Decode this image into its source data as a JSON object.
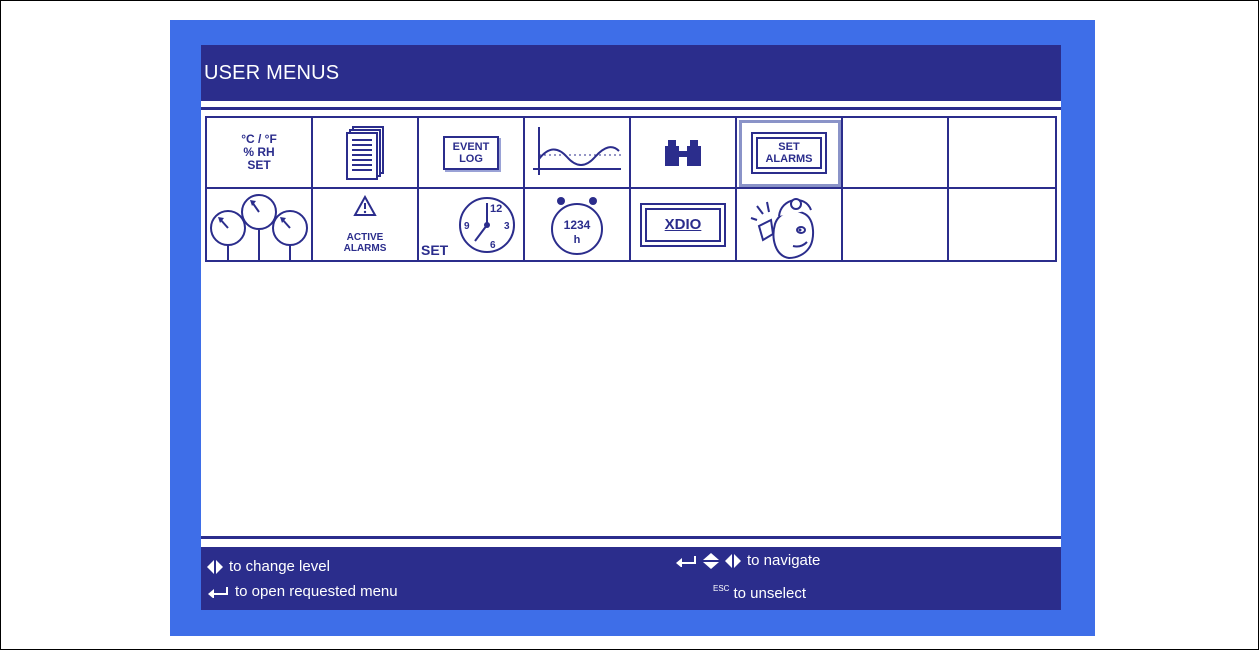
{
  "title": "USER MENUS",
  "menu_grid": {
    "row1": [
      {
        "name": "setpoints",
        "label": "°C / °F\n% RH\nSET",
        "icon": "temperature-humidity-set-icon"
      },
      {
        "name": "data-log",
        "icon": "document-stack-icon"
      },
      {
        "name": "event-log",
        "label": "EVENT\nLOG",
        "icon": "event-log-icon"
      },
      {
        "name": "graphs",
        "icon": "line-graph-icon"
      },
      {
        "name": "view",
        "icon": "binoculars-icon"
      },
      {
        "name": "set-alarms",
        "label": "SET\nALARMS",
        "icon": "set-alarms-icon",
        "selected": true
      },
      {
        "name": "empty-1",
        "icon": ""
      },
      {
        "name": "empty-2",
        "icon": ""
      }
    ],
    "row2": [
      {
        "name": "sensors",
        "icon": "gauges-icon"
      },
      {
        "name": "active-alarms",
        "label": "ACTIVE\nALARMS",
        "icon": "warning-triangle-icon"
      },
      {
        "name": "set-clock",
        "label": "SET",
        "icon": "clock-icon",
        "clock_numbers": [
          "12",
          "3",
          "6",
          "9"
        ]
      },
      {
        "name": "run-hours",
        "label": "1234",
        "sub": "h",
        "icon": "hour-counter-icon"
      },
      {
        "name": "xdio",
        "label": "XDIO",
        "icon": "xdio-icon"
      },
      {
        "name": "service-contacts",
        "icon": "service-person-icon"
      },
      {
        "name": "empty-3",
        "icon": ""
      },
      {
        "name": "empty-4",
        "icon": ""
      }
    ]
  },
  "footer": {
    "change_level": "to change level",
    "open_menu": "to open requested menu",
    "navigate": "to navigate",
    "esc_key": "ESC",
    "unselect": "to unselect"
  },
  "colors": {
    "frame_blue": "#3e6ee8",
    "navy": "#2b2d8c",
    "background": "#ffffff"
  }
}
